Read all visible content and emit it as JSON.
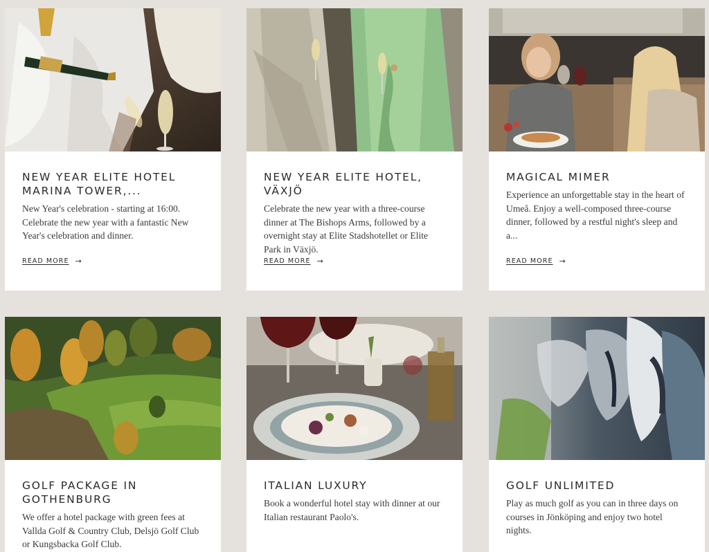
{
  "cards": [
    {
      "title": "NEW YEAR ELITE HOTEL MARINA TOWER,...",
      "description": "New Year's celebration - starting at 16:00. Celebrate the new year with a fantastic New Year's celebration and dinner.",
      "link": "READ MORE",
      "arrow": "→",
      "image": "champagne-celebration-photo"
    },
    {
      "title": "NEW YEAR ELITE HOTEL, VÄXJÖ",
      "description": "Celebrate the new year with a three-course dinner at The Bishops Arms, followed by a overnight stay at Elite Stadshotellet or Elite Park in Växjö.",
      "link": "READ MORE",
      "arrow": "→",
      "image": "women-toasting-photo"
    },
    {
      "title": "MAGICAL MIMER",
      "description": "Experience an unforgettable stay in the heart of Umeå. Enjoy a well-composed three-course dinner, followed by a restful night's sleep and a...",
      "link": "READ MORE",
      "arrow": "→",
      "image": "friends-dining-photo"
    },
    {
      "title": "GOLF PACKAGE IN GOTHENBURG",
      "description": "We offer a hotel package with green fees at Vallda Golf & Country Club, Delsjö Golf Club or Kungsbacka Golf Club.",
      "image": "golf-course-aerial-photo"
    },
    {
      "title": "ITALIAN LUXURY",
      "description": "Book a wonderful hotel stay with dinner at our Italian restaurant Paolo's.",
      "image": "italian-dinner-photo"
    },
    {
      "title": "GOLF UNLIMITED",
      "description": "Play as much golf as you can in three days on courses in Jönköping and enjoy two hotel nights.",
      "image": "golf-clubs-photo"
    }
  ]
}
